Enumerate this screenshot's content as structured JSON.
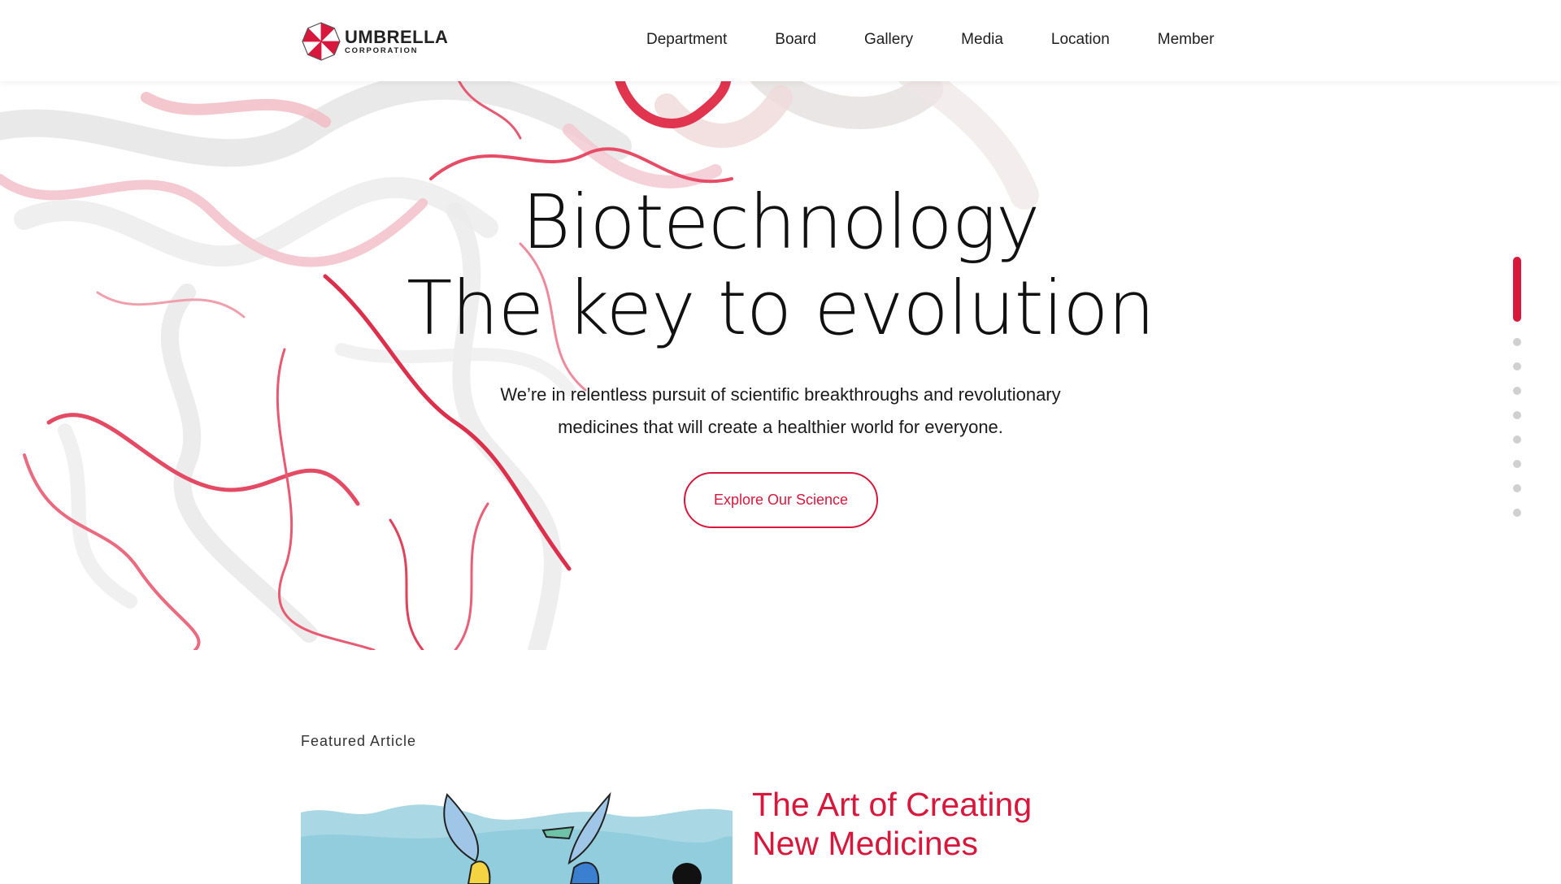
{
  "brand": {
    "name": "UMBRELLA",
    "sub": "CORPORATION",
    "logo_icon": "umbrella-logo-icon",
    "accent_color": "#d8173c"
  },
  "nav": {
    "items": [
      {
        "label": "Department"
      },
      {
        "label": "Board"
      },
      {
        "label": "Gallery"
      },
      {
        "label": "Media"
      },
      {
        "label": "Location"
      },
      {
        "label": "Member"
      }
    ]
  },
  "hero": {
    "title_line1": "Biotechnology",
    "title_line2": "The key to evolution",
    "desc_line1": "We’re in relentless pursuit of scientific breakthroughs and revolutionary",
    "desc_line2": "medicines that will create a healthier world for everyone.",
    "button": "Explore Our Science"
  },
  "pager": {
    "active_index": 0,
    "total": 9
  },
  "featured": {
    "label": "Featured Article",
    "title_line1": "The Art of Creating",
    "title_line2": "New Medicines"
  }
}
